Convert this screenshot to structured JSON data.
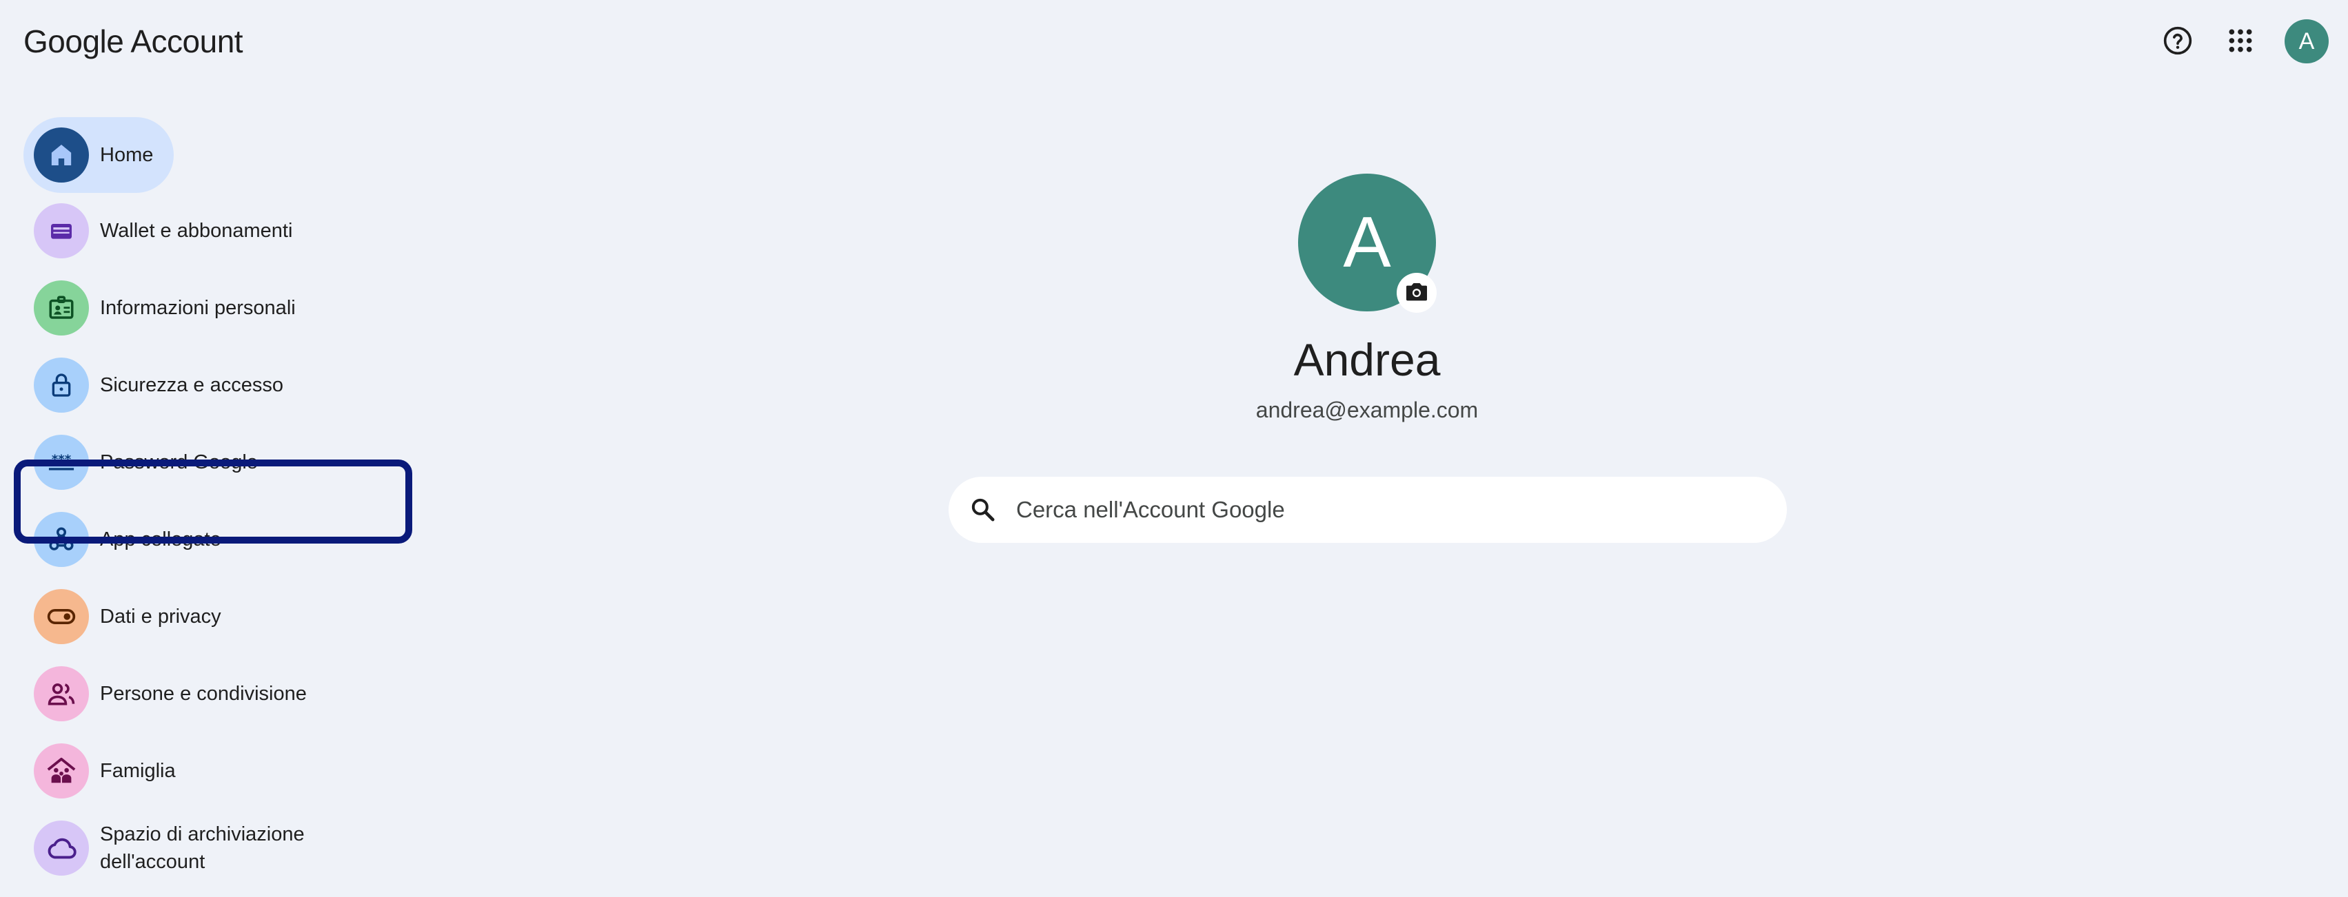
{
  "header": {
    "logo_google": "Google",
    "logo_account": "Account",
    "help_icon": "help-circle-icon",
    "apps_icon": "apps-grid-icon",
    "avatar_letter": "A"
  },
  "sidebar": {
    "items": [
      {
        "label": "Home",
        "icon": "home-icon",
        "bg": "#1d4e89",
        "active": true
      },
      {
        "label": "Wallet e abbonamenti",
        "icon": "wallet-icon",
        "bg": "#d7c6f7"
      },
      {
        "label": "Informazioni personali",
        "icon": "id-card-icon",
        "bg": "#86d49a"
      },
      {
        "label": "Sicurezza e accesso",
        "icon": "lock-icon",
        "bg": "#a8d0fb"
      },
      {
        "label": "Password Google",
        "icon": "password-icon",
        "bg": "#a8d0fb"
      },
      {
        "label": "App collegate",
        "icon": "connected-apps-icon",
        "bg": "#a8d0fb"
      },
      {
        "label": "Dati e privacy",
        "icon": "toggle-icon",
        "bg": "#f6b88e"
      },
      {
        "label": "Persone e condivisione",
        "icon": "people-icon",
        "bg": "#f4b6dc"
      },
      {
        "label": "Famiglia",
        "icon": "family-home-icon",
        "bg": "#f4b6dc"
      },
      {
        "label": "Spazio di archiviazione dell'account",
        "icon": "cloud-icon",
        "bg": "#d7c6f7"
      }
    ]
  },
  "profile": {
    "avatar_letter": "A",
    "name": "Andrea",
    "email": "andrea@example.com"
  },
  "search": {
    "placeholder": "Cerca nell'Account Google",
    "value": ""
  },
  "colors": {
    "background": "#eff2f8",
    "avatar": "#3d8a7e",
    "active_nav": "#d3e3fd",
    "selection_outline": "#0a1a7a"
  }
}
